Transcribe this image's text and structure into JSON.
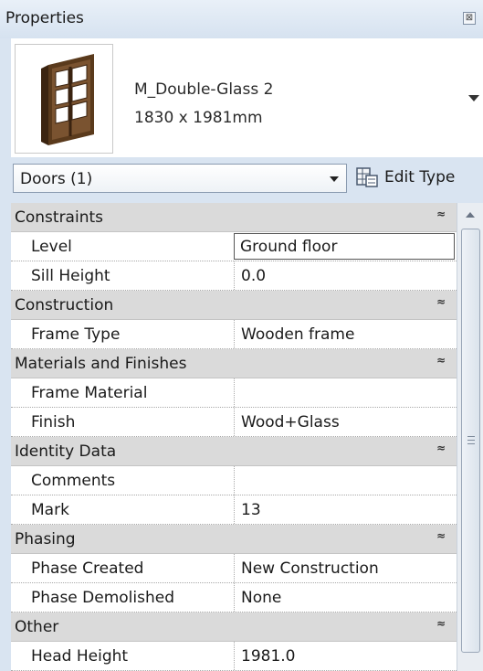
{
  "panel": {
    "title": "Properties",
    "close_glyph": "⊠"
  },
  "type_selector": {
    "name": "M_Double-Glass 2",
    "size": "1830 x 1981mm",
    "icon": "double-glass-door-icon"
  },
  "filter": {
    "selected": "Doors (1)",
    "edit_type_label": "Edit Type"
  },
  "groups": [
    {
      "name": "Constraints",
      "params": [
        {
          "name": "Level",
          "value": "Ground floor",
          "active": true
        },
        {
          "name": "Sill Height",
          "value": "0.0"
        }
      ]
    },
    {
      "name": "Construction",
      "params": [
        {
          "name": "Frame Type",
          "value": "Wooden frame"
        }
      ]
    },
    {
      "name": "Materials and Finishes",
      "params": [
        {
          "name": "Frame Material",
          "value": ""
        },
        {
          "name": "Finish",
          "value": "Wood+Glass"
        }
      ]
    },
    {
      "name": "Identity Data",
      "params": [
        {
          "name": "Comments",
          "value": ""
        },
        {
          "name": "Mark",
          "value": "13"
        }
      ]
    },
    {
      "name": "Phasing",
      "params": [
        {
          "name": "Phase Created",
          "value": "New Construction"
        },
        {
          "name": "Phase Demolished",
          "value": "None"
        }
      ]
    },
    {
      "name": "Other",
      "params": [
        {
          "name": "Head Height",
          "value": "1981.0"
        }
      ]
    }
  ],
  "collapse_glyph": "≈"
}
